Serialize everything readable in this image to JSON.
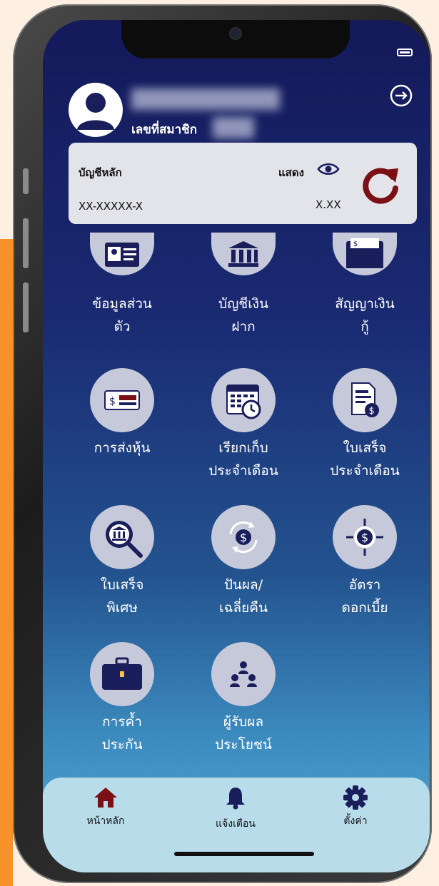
{
  "profile": {
    "member_label": "เลขที่สมาชิก"
  },
  "account_card": {
    "title": "บัญชีหลัก",
    "number": "XX-XXXXX-X",
    "show_label": "แสดง",
    "balance": "X.XX"
  },
  "menu": [
    {
      "line1": "ข้อมูลส่วน",
      "line2": "ตัว",
      "icon": "id-card-icon"
    },
    {
      "line1": "บัญชีเงิน",
      "line2": "ฝาก",
      "icon": "bank-icon"
    },
    {
      "line1": "สัญญาเงิน",
      "line2": "กู้",
      "icon": "folder-money-icon"
    },
    {
      "line1": "การส่งหุ้น",
      "line2": "",
      "icon": "money-bill-icon"
    },
    {
      "line1": "เรียกเก็บ",
      "line2": "ประจำเดือน",
      "icon": "calendar-clock-icon"
    },
    {
      "line1": "ใบเสร็จ",
      "line2": "ประจำเดือน",
      "icon": "receipt-icon"
    },
    {
      "line1": "ใบเสร็จ",
      "line2": "พิเศษ",
      "icon": "search-bank-icon"
    },
    {
      "line1": "ปันผล/",
      "line2": "เฉลี่ยคืน",
      "icon": "coin-cycle-icon"
    },
    {
      "line1": "อัตรา",
      "line2": "ดอกเบี้ย",
      "icon": "coin-target-icon"
    },
    {
      "line1": "การค้ำ",
      "line2": "ประกัน",
      "icon": "briefcase-icon"
    },
    {
      "line1": "ผู้รับผล",
      "line2": "ประโยชน์",
      "icon": "people-icon"
    }
  ],
  "tabbar": {
    "home": "หน้าหลัก",
    "notifications": "แจ้งเตือน",
    "settings": "ตั้งค่า"
  },
  "colors": {
    "accent_red": "#7a0f14",
    "navy": "#1a1f5c",
    "tabbar_bg": "#b9dceb"
  }
}
